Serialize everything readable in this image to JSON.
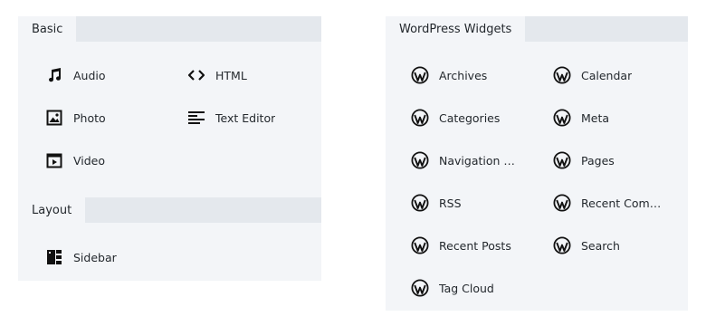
{
  "basic": {
    "title": "Basic",
    "items": [
      {
        "label": "Audio",
        "icon": "music-note-icon"
      },
      {
        "label": "HTML",
        "icon": "code-icon"
      },
      {
        "label": "Photo",
        "icon": "image-icon"
      },
      {
        "label": "Text Editor",
        "icon": "text-align-icon"
      },
      {
        "label": "Video",
        "icon": "film-icon"
      }
    ]
  },
  "layout": {
    "title": "Layout",
    "items": [
      {
        "label": "Sidebar",
        "icon": "sidebar-layout-icon"
      }
    ]
  },
  "wordpress": {
    "title": "WordPress Widgets",
    "items": [
      {
        "label": "Archives",
        "icon": "wordpress-icon"
      },
      {
        "label": "Calendar",
        "icon": "wordpress-icon"
      },
      {
        "label": "Categories",
        "icon": "wordpress-icon"
      },
      {
        "label": "Meta",
        "icon": "wordpress-icon"
      },
      {
        "label": "Navigation …",
        "icon": "wordpress-icon"
      },
      {
        "label": "Pages",
        "icon": "wordpress-icon"
      },
      {
        "label": "RSS",
        "icon": "wordpress-icon"
      },
      {
        "label": "Recent Com…",
        "icon": "wordpress-icon"
      },
      {
        "label": "Recent Posts",
        "icon": "wordpress-icon"
      },
      {
        "label": "Search",
        "icon": "wordpress-icon"
      },
      {
        "label": "Tag Cloud",
        "icon": "wordpress-icon"
      }
    ]
  },
  "colors": {
    "panel_bg": "#f3f5f8",
    "header_bg": "#e4e8ed",
    "text": "#23282d"
  }
}
